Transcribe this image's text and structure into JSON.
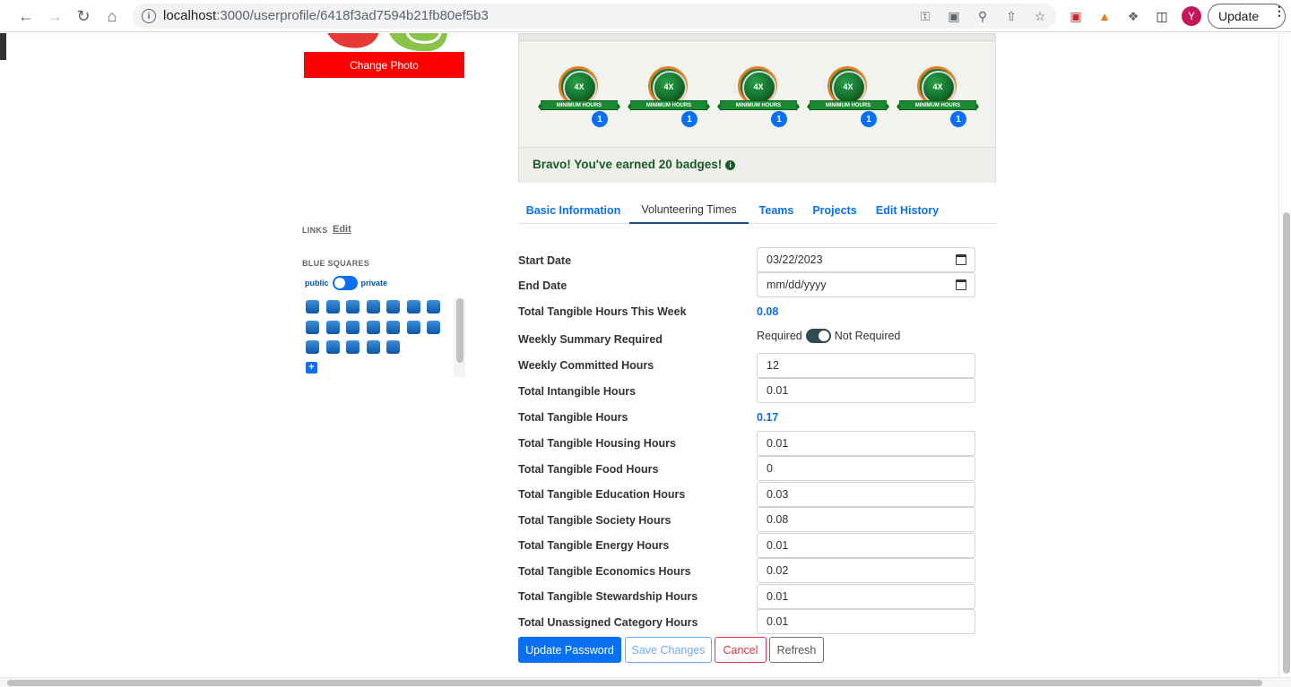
{
  "browser": {
    "url_host": "localhost",
    "url_path": ":3000/userprofile/6418f3ad7594b21fb80ef5b3",
    "profile_initial": "Y",
    "update_label": "Update"
  },
  "sidebar": {
    "change_photo_label": "Change Photo",
    "links_label": "LINKS",
    "links_edit_label": "Edit",
    "blue_squares_label": "BLUE SQUARES",
    "toggle_public": "public",
    "toggle_private": "private",
    "blue_square_count": 19
  },
  "badges": {
    "items": [
      {
        "title": "4X",
        "ribbon": "MINIMUM HOURS",
        "count": "1"
      },
      {
        "title": "4X",
        "ribbon": "MINIMUM HOURS",
        "count": "1"
      },
      {
        "title": "4X",
        "ribbon": "MINIMUM HOURS",
        "count": "1"
      },
      {
        "title": "4X",
        "ribbon": "MINIMUM HOURS",
        "count": "1"
      },
      {
        "title": "4X",
        "ribbon": "MINIMUM HOURS",
        "count": "1"
      }
    ],
    "summary": "Bravo! You've earned 20 badges!",
    "colors": {
      "medal_green": "#136f2c",
      "medal_rim": "#e07f25",
      "count_blue": "#0a6ff0"
    }
  },
  "tabs": [
    {
      "label": "Basic Information",
      "active": false
    },
    {
      "label": "Volunteering Times",
      "active": true
    },
    {
      "label": "Teams",
      "active": false
    },
    {
      "label": "Projects",
      "active": false
    },
    {
      "label": "Edit History",
      "active": false
    }
  ],
  "form": {
    "start_date": {
      "label": "Start Date",
      "value": "03/22/2023"
    },
    "end_date": {
      "label": "End Date",
      "placeholder": "mm/dd/yyyy"
    },
    "tangible_this_week": {
      "label": "Total Tangible Hours This Week",
      "value": "0.08"
    },
    "weekly_summary": {
      "label": "Weekly Summary Required",
      "on_label": "Required",
      "off_label": "Not Required"
    },
    "weekly_committed": {
      "label": "Weekly Committed Hours",
      "value": "12"
    },
    "intangible": {
      "label": "Total Intangible Hours",
      "value": "0.01"
    },
    "tangible_total": {
      "label": "Total Tangible Hours",
      "value": "0.17"
    },
    "housing": {
      "label": "Total Tangible Housing Hours",
      "value": "0.01"
    },
    "food": {
      "label": "Total Tangible Food Hours",
      "value": "0"
    },
    "education": {
      "label": "Total Tangible Education Hours",
      "value": "0.03"
    },
    "society": {
      "label": "Total Tangible Society Hours",
      "value": "0.08"
    },
    "energy": {
      "label": "Total Tangible Energy Hours",
      "value": "0.01"
    },
    "economics": {
      "label": "Total Tangible Economics Hours",
      "value": "0.02"
    },
    "stewardship": {
      "label": "Total Tangible Stewardship Hours",
      "value": "0.01"
    },
    "unassigned": {
      "label": "Total Unassigned Category Hours",
      "value": "0.01"
    }
  },
  "actions": {
    "update_password": "Update Password",
    "save_changes": "Save Changes",
    "cancel": "Cancel",
    "refresh": "Refresh"
  }
}
